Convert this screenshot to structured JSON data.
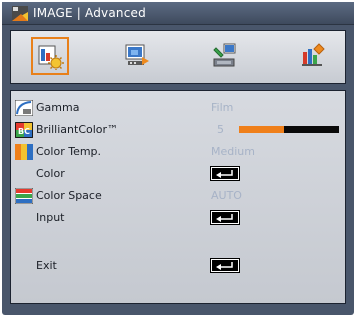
{
  "window": {
    "title": "IMAGE | Advanced"
  },
  "tabs": [
    {
      "name": "image",
      "icon": "image-settings-icon",
      "active": true
    },
    {
      "name": "display",
      "icon": "display-icon",
      "active": false
    },
    {
      "name": "setup",
      "icon": "setup-icon",
      "active": false
    },
    {
      "name": "options",
      "icon": "options-icon",
      "active": false
    }
  ],
  "menu": {
    "gamma": {
      "label": "Gamma",
      "value": "Film",
      "icon": "gamma-icon"
    },
    "brilliant": {
      "label": "BrilliantColor™",
      "value": "5",
      "level": 0.45,
      "icon": "brilliantcolor-icon"
    },
    "colortemp": {
      "label": "Color Temp.",
      "value": "Medium",
      "icon": "color-temp-icon"
    },
    "color": {
      "label": "Color",
      "action": "enter"
    },
    "colorspace": {
      "label": "Color Space",
      "value": "AUTO",
      "icon": "color-space-icon"
    },
    "input": {
      "label": "Input",
      "action": "enter"
    },
    "exit": {
      "label": "Exit",
      "action": "enter"
    }
  },
  "colors": {
    "accent": "#ef7f1a",
    "frame": "#49566b",
    "panel": "#d0d3d9",
    "value_text": "#a7b3c7"
  }
}
